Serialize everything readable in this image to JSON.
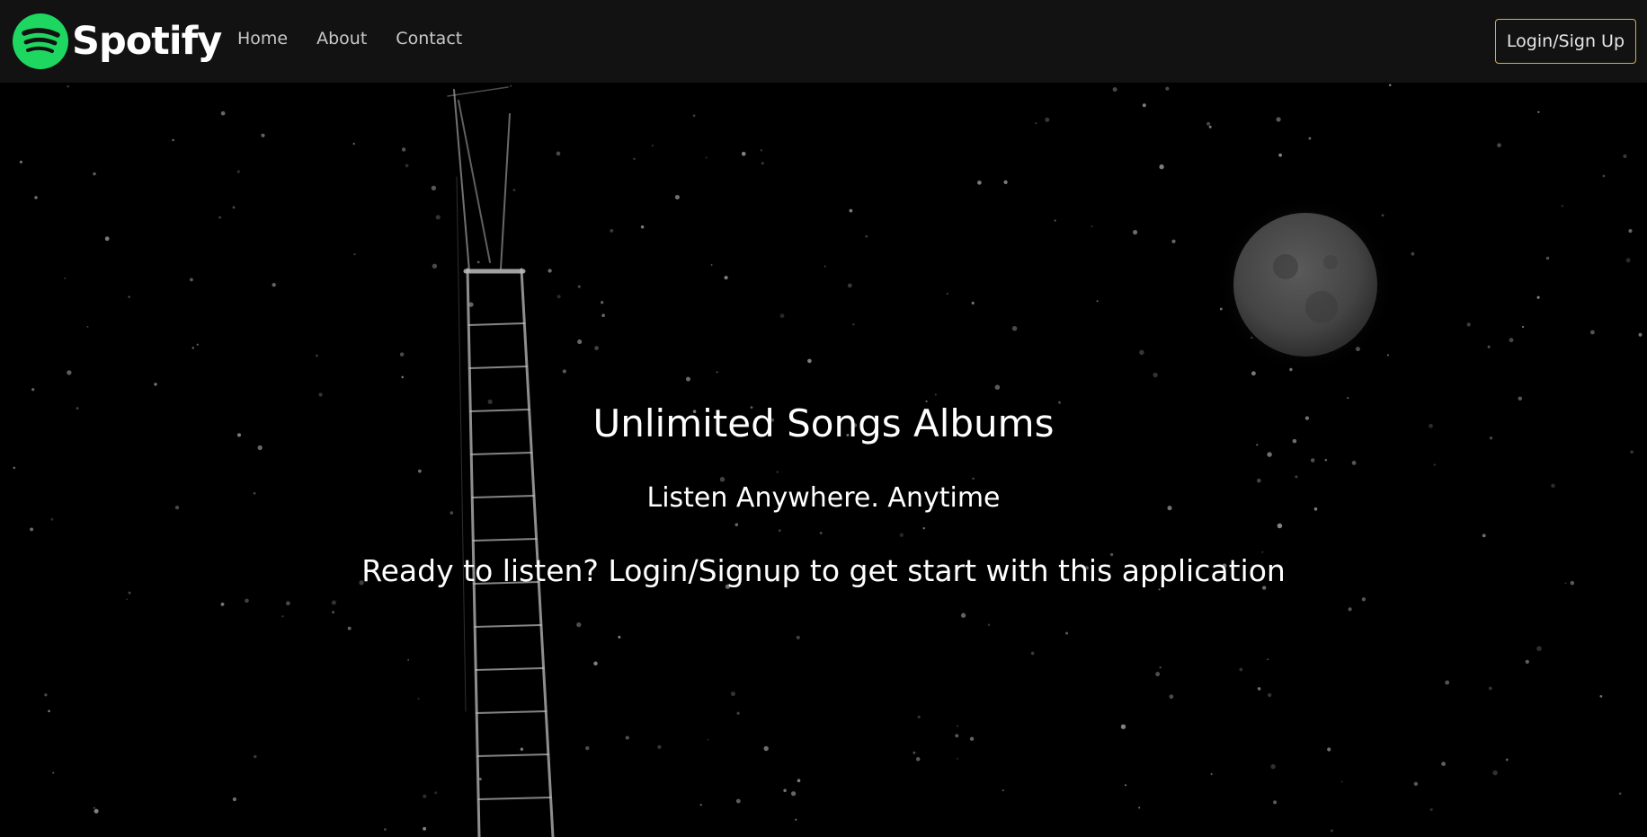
{
  "nav": {
    "brand": "Spotify",
    "links": [
      "Home",
      "About",
      "Contact"
    ],
    "login_label": "Login/Sign Up"
  },
  "hero": {
    "title": "Unlimited Songs Albums",
    "subtitle": "Listen Anywhere. Anytime",
    "cta_text": "Ready to listen? Login/Signup to get start with this application"
  },
  "colors": {
    "navbar_bg": "#121212",
    "brand_green": "#1ed760",
    "login_border": "#d4b04a",
    "page_bg": "#000000"
  },
  "icons": [
    "spotify-logo-icon",
    "moon-icon",
    "ladder-icon"
  ]
}
